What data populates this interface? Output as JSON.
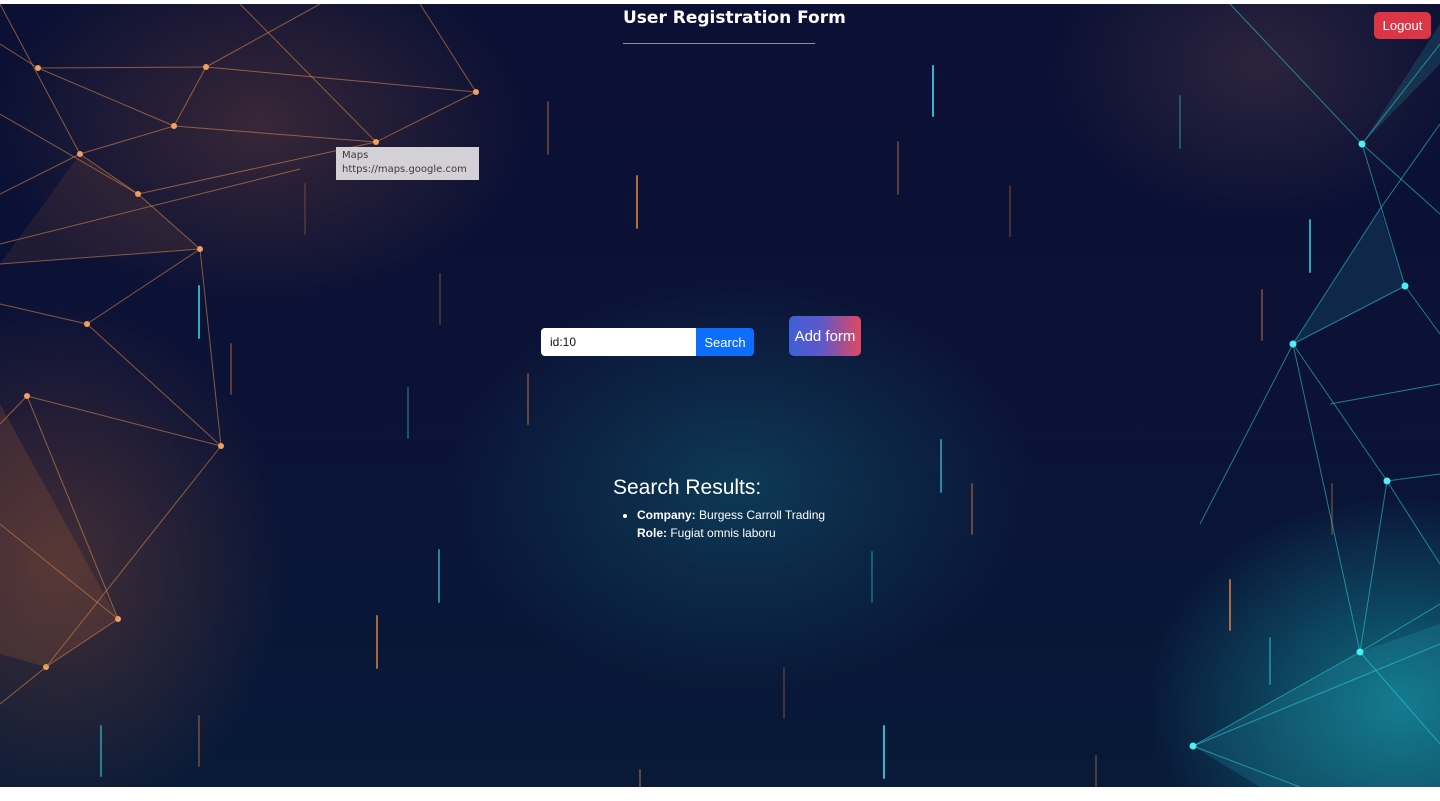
{
  "header": {
    "title": "User Registration Form",
    "logout_label": "Logout"
  },
  "tooltip": {
    "title": "Maps",
    "url": "https://maps.google.com"
  },
  "search": {
    "value": "id:10",
    "button_label": "Search"
  },
  "actions": {
    "add_form_label": "Add form"
  },
  "results": {
    "heading": "Search Results:",
    "items": [
      {
        "company_label": "Company:",
        "company": "Burgess Carroll Trading",
        "role_label": "Role:",
        "role": "Fugiat omnis laboru"
      }
    ]
  },
  "colors": {
    "background": "#0b1034",
    "logout": "#dc3545",
    "search_button": "#0d6efd",
    "add_form_gradient_start": "#3f5fd6",
    "add_form_gradient_end": "#e04860",
    "network_orange": "#e8914a",
    "network_cyan": "#2fd6e0"
  }
}
